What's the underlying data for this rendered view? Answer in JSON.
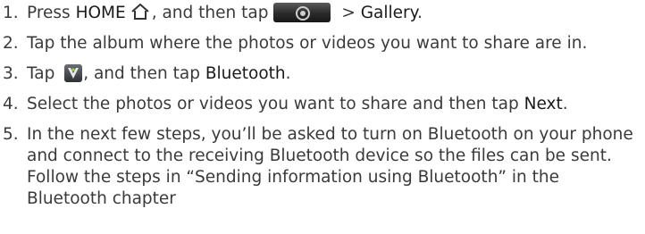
{
  "steps": [
    {
      "number": "1.",
      "before": "Press ",
      "home_word": "HOME",
      "mid": ", and then tap",
      "after": " > ",
      "gallery": "Gallery",
      "end": ".",
      "icons": [
        "home-icon",
        "all-apps-button-icon"
      ]
    },
    {
      "number": "2.",
      "text": "Tap the album where the photos or videos you want to share are in."
    },
    {
      "number": "3.",
      "before": "Tap ",
      "mid": ", and then tap ",
      "bluetooth": "Bluetooth",
      "end": ".",
      "icons": [
        "share-icon"
      ]
    },
    {
      "number": "4.",
      "before": "Select the photos or videos you want to share and then tap ",
      "next": "Next",
      "end": "."
    },
    {
      "number": "5.",
      "text": "In the next few steps, you’ll be asked to turn on Bluetooth on your phone and connect to the receiving Bluetooth device so the files can be sent. Follow the steps in “Sending information using Bluetooth” in the Bluetooth chapter"
    }
  ]
}
